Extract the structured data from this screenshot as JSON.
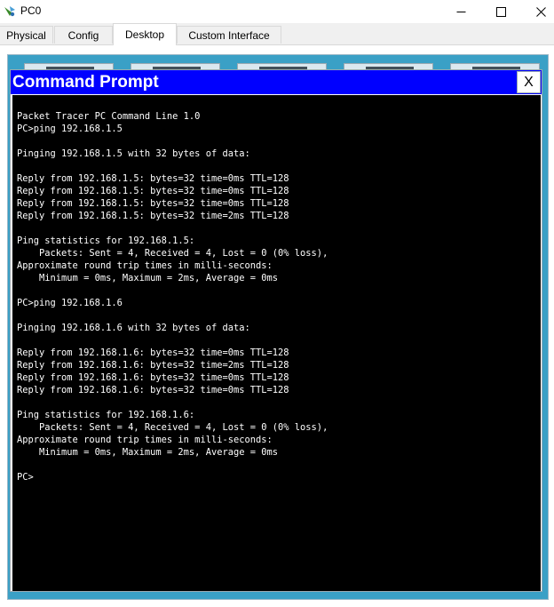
{
  "window": {
    "title": "PC0",
    "colors": {
      "titlebar_bg": "#ffffff",
      "desktop_bg": "#3aa0c6"
    },
    "icons": {
      "app": "packet-tracer-pc-icon",
      "minimize": "minimize-icon",
      "maximize": "maximize-icon",
      "close": "close-icon"
    }
  },
  "tabs": [
    {
      "label": "Physical",
      "active": false
    },
    {
      "label": "Config",
      "active": false
    },
    {
      "label": "Desktop",
      "active": true
    },
    {
      "label": "Custom Interface",
      "active": false
    }
  ],
  "command_prompt": {
    "title": "Command Prompt",
    "close_label": "X",
    "colors": {
      "titlebar": "#0000ff",
      "terminal_bg": "#000000",
      "terminal_fg": "#ffffff"
    },
    "lines": [
      "Packet Tracer PC Command Line 1.0",
      "PC>ping 192.168.1.5",
      "",
      "Pinging 192.168.1.5 with 32 bytes of data:",
      "",
      "Reply from 192.168.1.5: bytes=32 time=0ms TTL=128",
      "Reply from 192.168.1.5: bytes=32 time=0ms TTL=128",
      "Reply from 192.168.1.5: bytes=32 time=0ms TTL=128",
      "Reply from 192.168.1.5: bytes=32 time=2ms TTL=128",
      "",
      "Ping statistics for 192.168.1.5:",
      "    Packets: Sent = 4, Received = 4, Lost = 0 (0% loss),",
      "Approximate round trip times in milli-seconds:",
      "    Minimum = 0ms, Maximum = 2ms, Average = 0ms",
      "",
      "PC>ping 192.168.1.6",
      "",
      "Pinging 192.168.1.6 with 32 bytes of data:",
      "",
      "Reply from 192.168.1.6: bytes=32 time=0ms TTL=128",
      "Reply from 192.168.1.6: bytes=32 time=2ms TTL=128",
      "Reply from 192.168.1.6: bytes=32 time=0ms TTL=128",
      "Reply from 192.168.1.6: bytes=32 time=0ms TTL=128",
      "",
      "Ping statistics for 192.168.1.6:",
      "    Packets: Sent = 4, Received = 4, Lost = 0 (0% loss),",
      "Approximate round trip times in milli-seconds:",
      "    Minimum = 0ms, Maximum = 2ms, Average = 0ms",
      "",
      "PC>"
    ]
  }
}
